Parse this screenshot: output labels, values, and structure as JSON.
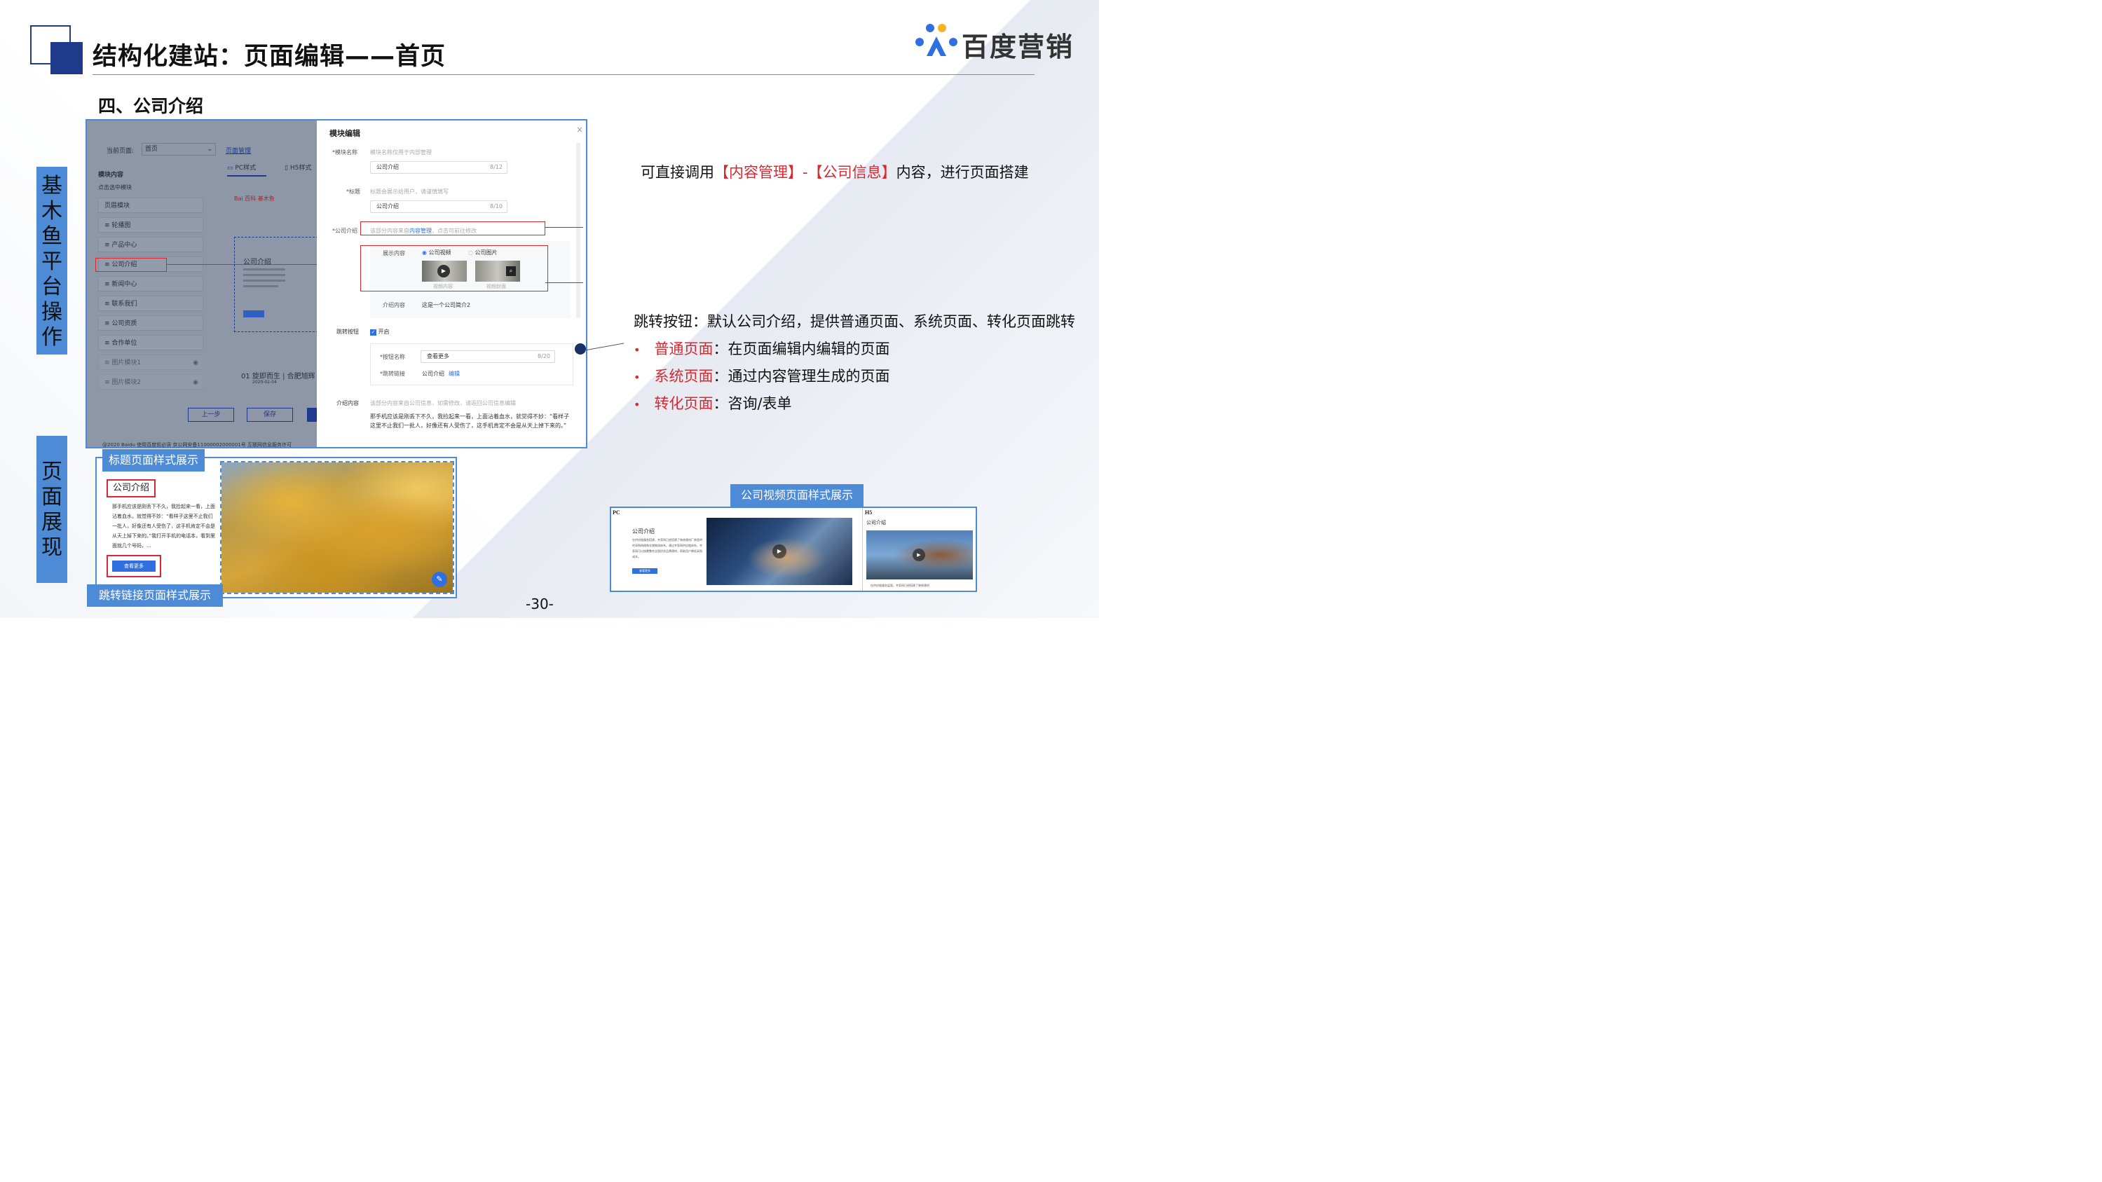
{
  "slide": {
    "title": "结构化建站：页面编辑——首页",
    "subtitle": "四、公司介绍",
    "brand": "百度营销",
    "page_number": "-30-"
  },
  "side_labels": {
    "platform": [
      "基",
      "木",
      "鱼",
      "平",
      "台",
      "操",
      "作"
    ],
    "display": [
      "页",
      "面",
      "展",
      "现"
    ]
  },
  "editor_left": {
    "current_page_label": "当前页面:",
    "current_page_value": "首页",
    "page_manage_link": "页面管理",
    "module_content_label": "模块内容",
    "module_hint": "点击选中模块",
    "pc_tab": "PC样式",
    "h5_tab": "H5样式",
    "modules": [
      "页眉模块",
      "轮播图",
      "产品中心",
      "公司介绍",
      "新闻中心",
      "联系我们",
      "公司资质",
      "合作单位",
      "图片模块1",
      "图片模块2"
    ],
    "preview_logo": "Bai 百科 基木鱼",
    "preview_title": "公司介绍",
    "preview_news": "01 旋即而生 | 合肥旭辉",
    "preview_date": "2020-02-04",
    "prev_button": "上一步",
    "save_button": "保存",
    "footer": "@2020 Baidu 使用百度前必读 京公网安备11000002000001号 互联网信息服务许可"
  },
  "modal": {
    "title": "模块编辑",
    "close": "×",
    "name_label": "*模块名称",
    "name_hint": "模块名称仅用于内部管理",
    "name_value": "公司介绍",
    "name_count": "8/12",
    "title_label": "*标题",
    "title_hint": "标题会展示给用户，请谨慎填写",
    "title_value": "公司介绍",
    "title_count": "8/10",
    "intro_label": "*公司介绍",
    "intro_hint_pre": "该部分内容来自",
    "intro_hint_link": "内容管理",
    "intro_hint_post": "，点击可前往修改",
    "display_label": "展示内容",
    "radio_video": "公司视频",
    "radio_image": "公司图片",
    "video_content_label": "视频内容",
    "video_cover_label": "视频封面",
    "intro_content_label": "介绍内容",
    "intro_content_value": "这是一个公司简介2",
    "jump_label": "跳转按钮",
    "jump_enabled": "开启",
    "btn_name_label": "*按钮名称",
    "btn_name_value": "查看更多",
    "btn_name_count": "8/20",
    "jump_link_label": "*跳转链接",
    "jump_link_value": "公司介绍",
    "jump_link_edit": "编辑",
    "intro2_label": "介绍内容",
    "intro2_hint": "该部分内容来自公司信息，如需修改，请返回公司信息编辑",
    "intro2_text": "那手机应该是刚丢下不久，我捡起来一看，上面沾着血水，就觉得不妙：“看样子这里不止我们一批人，好像还有人受伤了，这手机肯定不会是从天上掉下来的。”"
  },
  "right_text": {
    "line1_pre": "可直接调用",
    "line1_red1": "【内容管理】",
    "line1_dash": "-",
    "line1_red2": "【公司信息】",
    "line1_post": "内容，进行页面搭建",
    "jump_title": "跳转按钮：默认公司介绍，提供普通页面、系统页面、转化页面跳转",
    "bullets": [
      {
        "dot": "•",
        "term": "普通页面",
        "desc": "：在页面编辑内编辑的页面"
      },
      {
        "dot": "•",
        "term": "系统页面",
        "desc": "：通过内容管理生成的页面"
      },
      {
        "dot": "•",
        "term": "转化页面",
        "desc": "：咨询/表单"
      }
    ]
  },
  "preview_title_style": {
    "tab_label": "标题页面样式展示",
    "heading": "公司介绍",
    "body": "那手机应该是刚丢下不久，我捡起来一看，上面沾着血水，就觉得不妙：“看样子这里不止我们一批人，好像还有人受伤了，这手机肯定不会是从天上掉下来的。”我打开手机的电话本，看到里面就几个号码，...",
    "button": "查看更多",
    "link_tab_label": "跳转链接页面样式展示"
  },
  "preview_video_style": {
    "tab_label": "公司视频页面样式展示",
    "pc_label": "PC",
    "h5_label": "H5",
    "pc_heading": "公司介绍",
    "pc_body": "在供应链服务搭建，齐家网已经搭建了装修建材厂商直供的采购网络和仓储物流体系。通过齐家网供应链体系，齐家网可以按需整合全国优质品牌建材，帮助用户降低采购成本。",
    "pc_button": "查看更多",
    "h5_heading": "公司介绍",
    "h5_footer": "在供应链服务层面，齐家网已经搭建了装修建材"
  }
}
